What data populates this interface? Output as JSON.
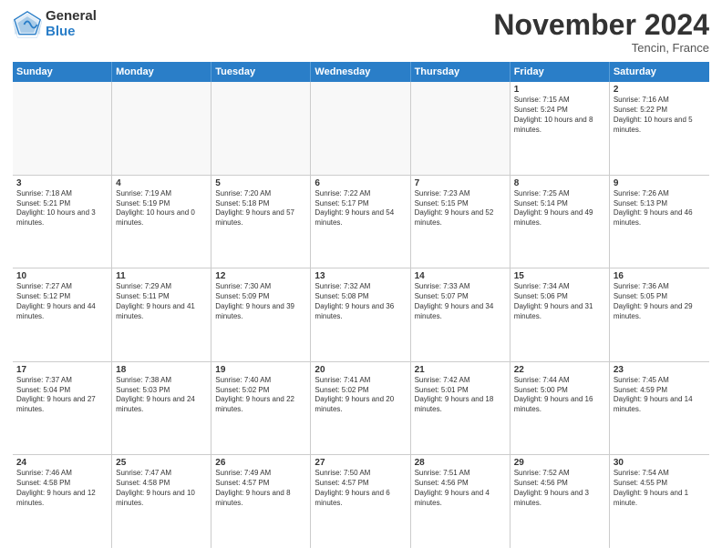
{
  "logo": {
    "general": "General",
    "blue": "Blue"
  },
  "header": {
    "month": "November 2024",
    "location": "Tencin, France"
  },
  "weekdays": [
    "Sunday",
    "Monday",
    "Tuesday",
    "Wednesday",
    "Thursday",
    "Friday",
    "Saturday"
  ],
  "rows": [
    [
      {
        "day": "",
        "text": ""
      },
      {
        "day": "",
        "text": ""
      },
      {
        "day": "",
        "text": ""
      },
      {
        "day": "",
        "text": ""
      },
      {
        "day": "",
        "text": ""
      },
      {
        "day": "1",
        "text": "Sunrise: 7:15 AM\nSunset: 5:24 PM\nDaylight: 10 hours and 8 minutes."
      },
      {
        "day": "2",
        "text": "Sunrise: 7:16 AM\nSunset: 5:22 PM\nDaylight: 10 hours and 5 minutes."
      }
    ],
    [
      {
        "day": "3",
        "text": "Sunrise: 7:18 AM\nSunset: 5:21 PM\nDaylight: 10 hours and 3 minutes."
      },
      {
        "day": "4",
        "text": "Sunrise: 7:19 AM\nSunset: 5:19 PM\nDaylight: 10 hours and 0 minutes."
      },
      {
        "day": "5",
        "text": "Sunrise: 7:20 AM\nSunset: 5:18 PM\nDaylight: 9 hours and 57 minutes."
      },
      {
        "day": "6",
        "text": "Sunrise: 7:22 AM\nSunset: 5:17 PM\nDaylight: 9 hours and 54 minutes."
      },
      {
        "day": "7",
        "text": "Sunrise: 7:23 AM\nSunset: 5:15 PM\nDaylight: 9 hours and 52 minutes."
      },
      {
        "day": "8",
        "text": "Sunrise: 7:25 AM\nSunset: 5:14 PM\nDaylight: 9 hours and 49 minutes."
      },
      {
        "day": "9",
        "text": "Sunrise: 7:26 AM\nSunset: 5:13 PM\nDaylight: 9 hours and 46 minutes."
      }
    ],
    [
      {
        "day": "10",
        "text": "Sunrise: 7:27 AM\nSunset: 5:12 PM\nDaylight: 9 hours and 44 minutes."
      },
      {
        "day": "11",
        "text": "Sunrise: 7:29 AM\nSunset: 5:11 PM\nDaylight: 9 hours and 41 minutes."
      },
      {
        "day": "12",
        "text": "Sunrise: 7:30 AM\nSunset: 5:09 PM\nDaylight: 9 hours and 39 minutes."
      },
      {
        "day": "13",
        "text": "Sunrise: 7:32 AM\nSunset: 5:08 PM\nDaylight: 9 hours and 36 minutes."
      },
      {
        "day": "14",
        "text": "Sunrise: 7:33 AM\nSunset: 5:07 PM\nDaylight: 9 hours and 34 minutes."
      },
      {
        "day": "15",
        "text": "Sunrise: 7:34 AM\nSunset: 5:06 PM\nDaylight: 9 hours and 31 minutes."
      },
      {
        "day": "16",
        "text": "Sunrise: 7:36 AM\nSunset: 5:05 PM\nDaylight: 9 hours and 29 minutes."
      }
    ],
    [
      {
        "day": "17",
        "text": "Sunrise: 7:37 AM\nSunset: 5:04 PM\nDaylight: 9 hours and 27 minutes."
      },
      {
        "day": "18",
        "text": "Sunrise: 7:38 AM\nSunset: 5:03 PM\nDaylight: 9 hours and 24 minutes."
      },
      {
        "day": "19",
        "text": "Sunrise: 7:40 AM\nSunset: 5:02 PM\nDaylight: 9 hours and 22 minutes."
      },
      {
        "day": "20",
        "text": "Sunrise: 7:41 AM\nSunset: 5:02 PM\nDaylight: 9 hours and 20 minutes."
      },
      {
        "day": "21",
        "text": "Sunrise: 7:42 AM\nSunset: 5:01 PM\nDaylight: 9 hours and 18 minutes."
      },
      {
        "day": "22",
        "text": "Sunrise: 7:44 AM\nSunset: 5:00 PM\nDaylight: 9 hours and 16 minutes."
      },
      {
        "day": "23",
        "text": "Sunrise: 7:45 AM\nSunset: 4:59 PM\nDaylight: 9 hours and 14 minutes."
      }
    ],
    [
      {
        "day": "24",
        "text": "Sunrise: 7:46 AM\nSunset: 4:58 PM\nDaylight: 9 hours and 12 minutes."
      },
      {
        "day": "25",
        "text": "Sunrise: 7:47 AM\nSunset: 4:58 PM\nDaylight: 9 hours and 10 minutes."
      },
      {
        "day": "26",
        "text": "Sunrise: 7:49 AM\nSunset: 4:57 PM\nDaylight: 9 hours and 8 minutes."
      },
      {
        "day": "27",
        "text": "Sunrise: 7:50 AM\nSunset: 4:57 PM\nDaylight: 9 hours and 6 minutes."
      },
      {
        "day": "28",
        "text": "Sunrise: 7:51 AM\nSunset: 4:56 PM\nDaylight: 9 hours and 4 minutes."
      },
      {
        "day": "29",
        "text": "Sunrise: 7:52 AM\nSunset: 4:56 PM\nDaylight: 9 hours and 3 minutes."
      },
      {
        "day": "30",
        "text": "Sunrise: 7:54 AM\nSunset: 4:55 PM\nDaylight: 9 hours and 1 minute."
      }
    ]
  ]
}
